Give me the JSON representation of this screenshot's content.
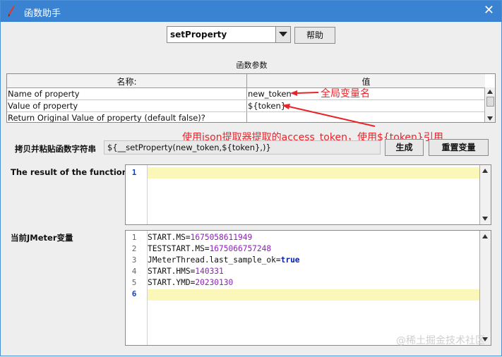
{
  "window": {
    "title": "函数助手",
    "close_glyph": "✕"
  },
  "function_select": {
    "value": "setProperty"
  },
  "help_button": "帮助",
  "params_section_title": "函数参数",
  "params_table": {
    "headers": [
      "名称:",
      "值"
    ],
    "rows": [
      {
        "name": "Name of property",
        "value": "new_token"
      },
      {
        "name": "Value of property",
        "value": "${token}"
      },
      {
        "name": "Return Original Value of property (default false)?",
        "value": ""
      }
    ]
  },
  "annotations": {
    "global_var": "全局变量名",
    "usage_note": "使用json提取器提取的access_token，使用${token}引用"
  },
  "copy_paste": {
    "label": "拷贝并粘贴函数字符串",
    "value": "${__setProperty(new_token,${token},)}",
    "generate_button": "生成",
    "reset_button": "重置变量"
  },
  "result": {
    "label": "The result of the function is",
    "line_numbers": [
      "1"
    ]
  },
  "jmeter_vars": {
    "label": "当前JMeter变量",
    "line_numbers": [
      "1",
      "2",
      "3",
      "4",
      "5",
      "6"
    ],
    "lines": [
      {
        "key": "START.MS=",
        "val": "1675058611949",
        "val_type": "number"
      },
      {
        "key": "TESTSTART.MS=",
        "val": "1675066757248",
        "val_type": "number"
      },
      {
        "key": "JMeterThread.last_sample_ok=",
        "val": "true",
        "val_type": "keyword"
      },
      {
        "key": "START.HMS=",
        "val": "140331",
        "val_type": "number"
      },
      {
        "key": "START.YMD=",
        "val": "20230130",
        "val_type": "number"
      }
    ]
  },
  "watermark": "@稀土掘金技术社区",
  "colors": {
    "titlebar": "#3a82d2",
    "annotation": "#e8242a",
    "current_line": "#fbf7b8"
  }
}
